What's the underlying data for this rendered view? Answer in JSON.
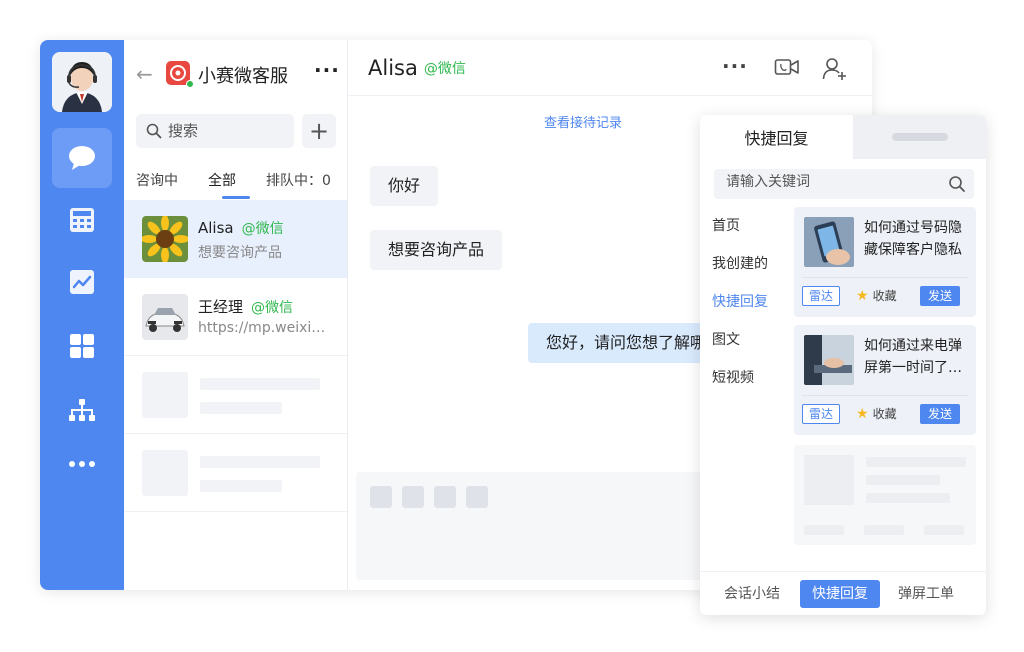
{
  "rail": {
    "items": [
      {
        "icon": "chat-bubble-icon",
        "active": true
      },
      {
        "icon": "calculator-icon",
        "active": false
      },
      {
        "icon": "chart-icon",
        "active": false
      },
      {
        "icon": "grid-icon",
        "active": false
      },
      {
        "icon": "org-tree-icon",
        "active": false
      },
      {
        "icon": "more-dots-icon",
        "active": false
      }
    ]
  },
  "conversations": {
    "app_name": "小赛微客服",
    "more": "···",
    "search_placeholder": "搜索",
    "add_label": "+",
    "tabs": {
      "consulting": "咨询中",
      "all": "全部",
      "queue": "排队中：0"
    },
    "items": [
      {
        "name": "Alisa",
        "tag": "@微信",
        "message": "想要咨询产品"
      },
      {
        "name": "王经理",
        "tag": "@微信",
        "message": "https://mp.weixin.qq.com"
      }
    ]
  },
  "chat": {
    "name": "Alisa",
    "tag": "@微信",
    "more": "···",
    "history_link": "查看接待记录",
    "messages": [
      {
        "direction": "in",
        "text": "你好"
      },
      {
        "direction": "in",
        "text": "想要咨询产品"
      },
      {
        "direction": "out",
        "text": "您好，请问您想了解哪款"
      }
    ]
  },
  "quick_reply": {
    "tab_title": "快捷回复",
    "search_placeholder": "请输入关键词",
    "categories": [
      "首页",
      "我创建的",
      "快捷回复",
      "图文",
      "短视频"
    ],
    "active_category": "快捷回复",
    "cards": [
      {
        "title": "如何通过号码隐藏保障客户隐私",
        "radar": "雷达",
        "favorite": "收藏",
        "send": "发送"
      },
      {
        "title": "如何通过来电弹屏第一时间了解客户",
        "radar": "雷达",
        "favorite": "收藏",
        "send": "发送"
      }
    ],
    "footer": {
      "summary": "会话小结",
      "quick_reply": "快捷回复",
      "popup_ticket": "弹屏工单"
    }
  },
  "colors": {
    "accent": "#4f87f0",
    "wechat_green": "#2fb84e",
    "brand_red": "#e8483f",
    "star": "#f5b91f"
  }
}
